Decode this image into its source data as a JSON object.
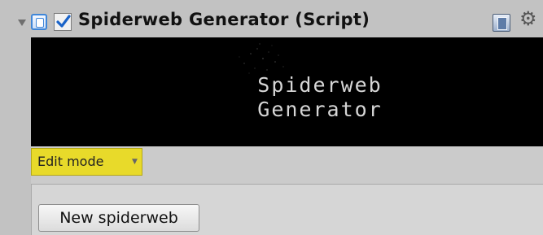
{
  "component": {
    "title": "Spiderweb Generator (Script)",
    "enabled": true,
    "icons": {
      "foldout": "foldout-arrow-icon",
      "script": "script-icon",
      "checkbox": "checkbox-icon",
      "help": "help-book-icon",
      "settings": "gear-icon"
    }
  },
  "banner": {
    "line1": "Spiderweb",
    "line2": "Generator"
  },
  "toolbar": {
    "mode_label": "Edit mode",
    "mode_color": "#e8da2a"
  },
  "panel": {
    "new_button_label": "New spiderweb"
  }
}
